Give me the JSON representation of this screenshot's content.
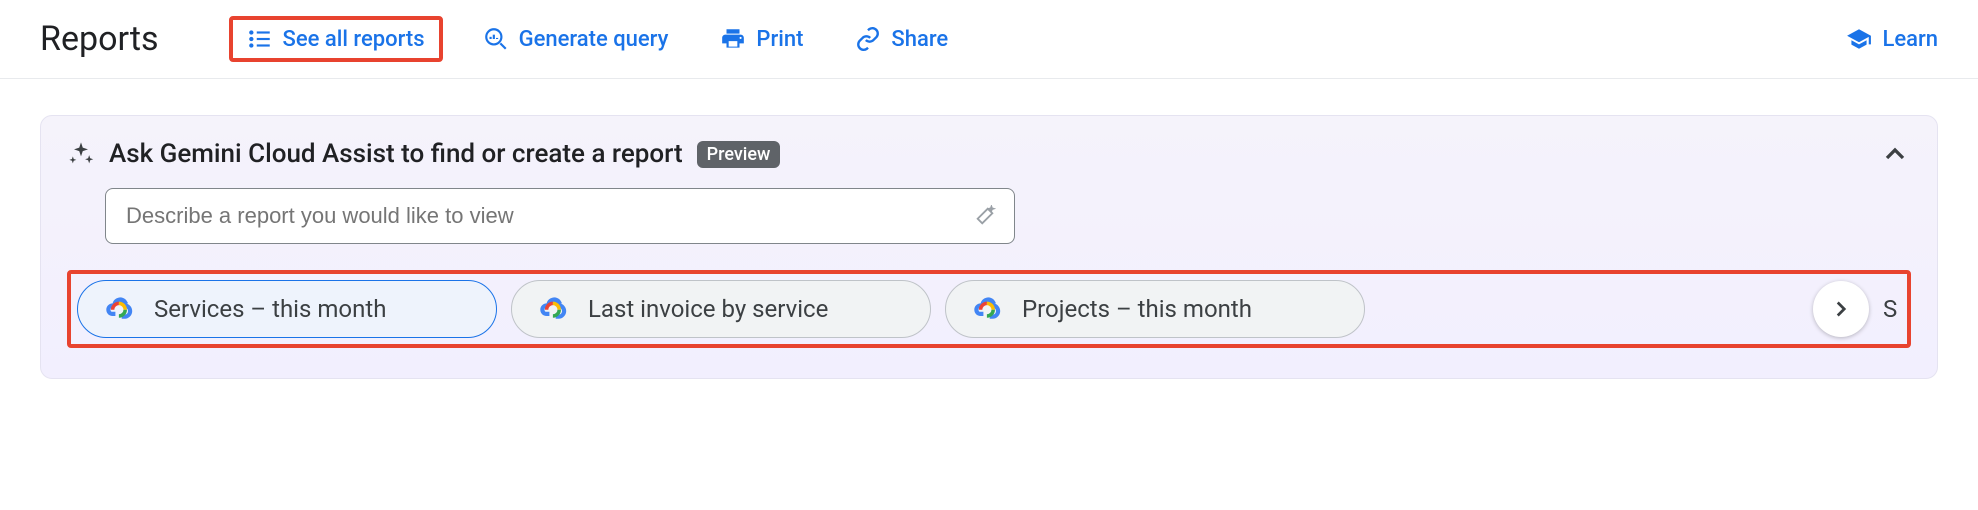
{
  "header": {
    "title": "Reports",
    "actions": {
      "see_all": "See all reports",
      "generate": "Generate query",
      "print": "Print",
      "share": "Share",
      "learn": "Learn"
    }
  },
  "panel": {
    "title": "Ask Gemini Cloud Assist to find or create a report",
    "badge": "Preview",
    "search_placeholder": "Describe a report you would like to view",
    "chips": [
      {
        "label": "Services – this month",
        "selected": true
      },
      {
        "label": "Last invoice by service",
        "selected": false
      },
      {
        "label": "Projects – this month",
        "selected": false
      }
    ],
    "peek_letter": "S"
  }
}
